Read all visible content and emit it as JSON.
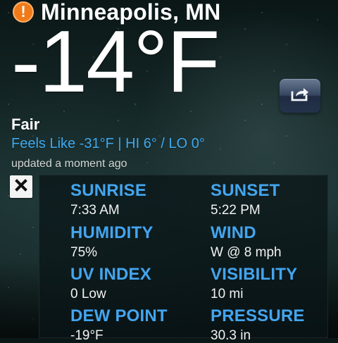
{
  "header": {
    "alert_icon": "!",
    "location": "Minneapolis, MN",
    "temperature": "-14°F"
  },
  "current": {
    "condition": "Fair",
    "feels_like_line": "Feels Like -31°F | HI 6° / LO 0°",
    "updated_text": "updated a moment ago"
  },
  "details": {
    "sunrise": {
      "label": "SUNRISE",
      "value": "7:33 AM"
    },
    "sunset": {
      "label": "SUNSET",
      "value": "5:22 PM"
    },
    "humidity": {
      "label": "HUMIDITY",
      "value": "75%"
    },
    "wind": {
      "label": "WIND",
      "value": "W @ 8 mph"
    },
    "uv_index": {
      "label": "UV INDEX",
      "value": "0 Low"
    },
    "visibility": {
      "label": "VISIBILITY",
      "value": "10 mi"
    },
    "dew_point": {
      "label": "DEW POINT",
      "value": "-19°F"
    },
    "pressure": {
      "label": "PRESSURE",
      "value": "30.3 in"
    }
  },
  "icons": {
    "alert": "alert-icon",
    "share": "share-icon",
    "close": "close-icon"
  },
  "colors": {
    "alert_orange": "#f07a1a",
    "accent_blue": "#44a5ee",
    "feels_like_blue": "#3fa9ef"
  }
}
